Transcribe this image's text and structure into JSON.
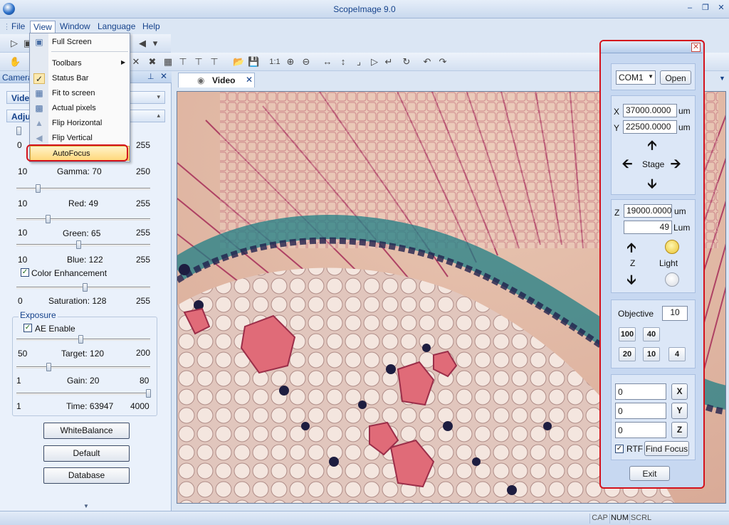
{
  "window": {
    "title": "ScopeImage 9.0"
  },
  "menubar": {
    "items": [
      "File",
      "View",
      "Window",
      "Language",
      "Help"
    ]
  },
  "view_menu": {
    "items": [
      {
        "label": "Full Screen",
        "icon": "monitor-icon"
      },
      {
        "label": "Toolbars",
        "icon": ""
      },
      {
        "label": "Status Bar",
        "icon": "checkmark-icon"
      },
      {
        "label": "Fit to screen",
        "icon": "fit-icon"
      },
      {
        "label": "Actual pixels",
        "icon": "actual-pixels-icon"
      },
      {
        "label": "Flip Horizontal",
        "icon": "flip-horizontal-icon"
      },
      {
        "label": "Flip Vertical",
        "icon": "flip-vertical-icon"
      },
      {
        "label": "AutoFocus",
        "icon": ""
      }
    ]
  },
  "left_panel": {
    "header": "Camera",
    "section_video": "Video",
    "section_adjust": "Adju",
    "top_slider": {
      "min": "0",
      "max": "255"
    },
    "gamma": {
      "min": "10",
      "label": "Gamma: 70",
      "max": "250"
    },
    "red": {
      "min": "10",
      "label": "Red: 49",
      "max": "255"
    },
    "green": {
      "min": "10",
      "label": "Green: 65",
      "max": "255"
    },
    "blue": {
      "min": "10",
      "label": "Blue: 122",
      "max": "255"
    },
    "color_enhancement": "Color Enhancement",
    "saturation": {
      "min": "0",
      "label": "Saturation: 128",
      "max": "255"
    },
    "exposure_title": "Exposure",
    "ae_enable": "AE Enable",
    "target": {
      "min": "50",
      "label": "Target: 120",
      "max": "200"
    },
    "gain": {
      "min": "1",
      "label": "Gain: 20",
      "max": "80"
    },
    "time": {
      "min": "1",
      "label": "Time: 63947",
      "max": "4000"
    },
    "buttons": {
      "white_balance": "WhiteBalance",
      "default": "Default",
      "database": "Database"
    }
  },
  "tabs": {
    "video": "Video"
  },
  "stage": {
    "port": "COM1",
    "open": "Open",
    "x_label": "X",
    "x_value": "37000.0000",
    "y_label": "Y",
    "y_value": "22500.0000",
    "unit": "um",
    "stage_label": "Stage",
    "z_label": "Z",
    "z_value": "19000.0000",
    "lum_value": "49",
    "lum_label": "Lum",
    "z_caption": "Z",
    "light_caption": "Light",
    "objective_label": "Objective",
    "objective_value": "10",
    "objectives": [
      "100",
      "40",
      "20",
      "10",
      "4"
    ],
    "fields": [
      {
        "value": "0",
        "btn": "X"
      },
      {
        "value": "0",
        "btn": "Y"
      },
      {
        "value": "0",
        "btn": "Z"
      }
    ],
    "rtf": "RTF",
    "find_focus": "Find Focus",
    "exit": "Exit"
  },
  "statusbar": {
    "cap": "CAP",
    "num": "NUM",
    "scrl": "SCRL"
  },
  "colors": {
    "highlight_red": "#d4121c",
    "accent_blue": "#15428b"
  }
}
